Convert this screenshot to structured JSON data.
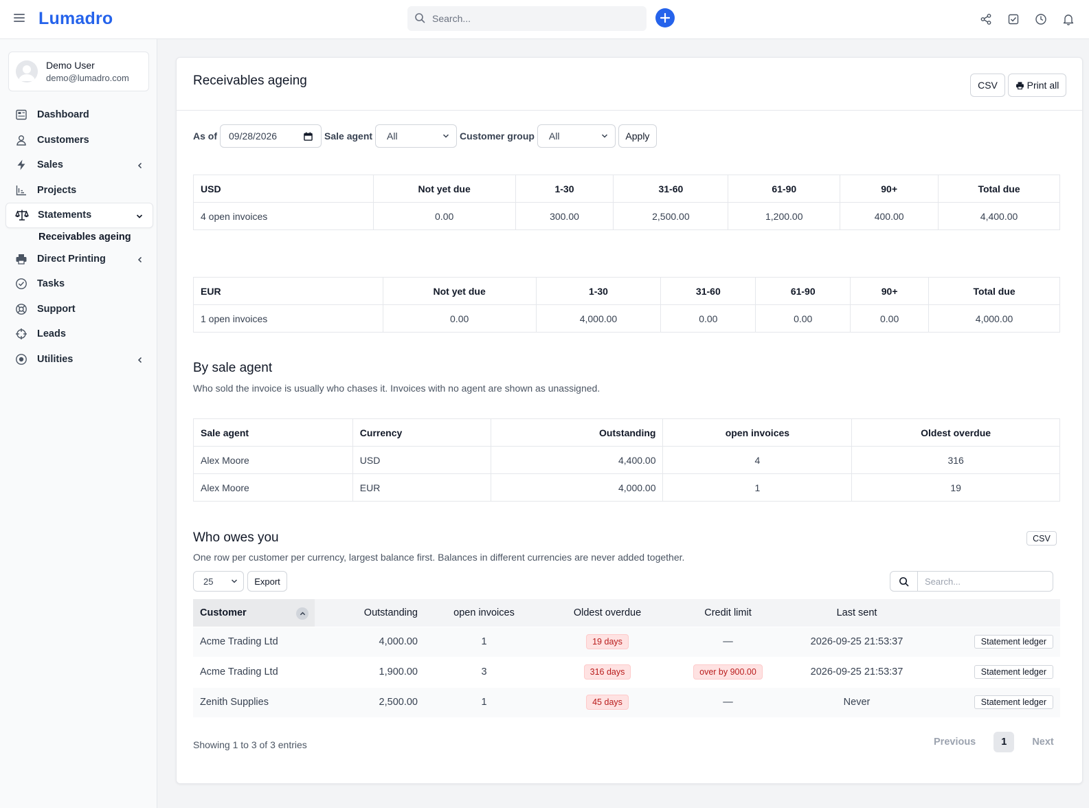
{
  "app": {
    "brand": "Lumadro"
  },
  "topbar": {
    "search_placeholder": "Search..."
  },
  "user": {
    "name": "Demo User",
    "email": "demo@lumadro.com"
  },
  "sidebar": {
    "items": [
      {
        "label": "Dashboard",
        "icon": "dashboard-icon"
      },
      {
        "label": "Customers",
        "icon": "user-icon"
      },
      {
        "label": "Sales",
        "icon": "bolt-icon"
      },
      {
        "label": "Projects",
        "icon": "chart-icon"
      },
      {
        "label": "Statements",
        "icon": "scale-icon"
      },
      {
        "label": "Direct Printing",
        "icon": "printer-icon"
      },
      {
        "label": "Tasks",
        "icon": "check-circle-icon"
      },
      {
        "label": "Support",
        "icon": "lifebuoy-icon"
      },
      {
        "label": "Leads",
        "icon": "crosshair-icon"
      },
      {
        "label": "Utilities",
        "icon": "record-icon"
      }
    ],
    "sub_item": "Receivables ageing"
  },
  "page": {
    "title": "Receivables ageing",
    "csv_label": "CSV",
    "print_label": "Print all"
  },
  "filters": {
    "as_of_label": "As of",
    "as_of_value": "09/28/2026",
    "sale_agent_label": "Sale agent",
    "sale_agent_value": "All",
    "customer_group_label": "Customer group",
    "customer_group_value": "All",
    "apply_label": "Apply"
  },
  "currency_tables": [
    {
      "headers": [
        "USD",
        "Not yet due",
        "1-30",
        "31-60",
        "61-90",
        "90+",
        "Total due"
      ],
      "row": [
        "4 open invoices",
        "0.00",
        "300.00",
        "2,500.00",
        "1,200.00",
        "400.00",
        "4,400.00"
      ]
    },
    {
      "headers": [
        "EUR",
        "Not yet due",
        "1-30",
        "31-60",
        "61-90",
        "90+",
        "Total due"
      ],
      "row": [
        "1 open invoices",
        "0.00",
        "4,000.00",
        "0.00",
        "0.00",
        "0.00",
        "4,000.00"
      ]
    }
  ],
  "agent_section": {
    "title": "By sale agent",
    "description": "Who sold the invoice is usually who chases it. Invoices with no agent are shown as unassigned.",
    "headers": [
      "Sale agent",
      "Currency",
      "Outstanding",
      "open invoices",
      "Oldest overdue"
    ],
    "rows": [
      [
        "Alex Moore",
        "USD",
        "4,400.00",
        "4",
        "316"
      ],
      [
        "Alex Moore",
        "EUR",
        "4,000.00",
        "1",
        "19"
      ]
    ]
  },
  "owes_section": {
    "title": "Who owes you",
    "description": "One row per customer per currency, largest balance first. Balances in different currencies are never added together.",
    "csv_label": "CSV",
    "page_length": "25",
    "export_label": "Export",
    "search_placeholder": "Search...",
    "headers": [
      "Customer",
      "Outstanding",
      "open invoices",
      "Oldest overdue",
      "Credit limit",
      "Last sent",
      ""
    ],
    "rows": [
      {
        "customer": "Acme Trading Ltd",
        "outstanding": "4,000.00",
        "open": "1",
        "overdue": "19 days",
        "credit": "—",
        "credit_badge": false,
        "last_sent": "2026-09-25 21:53:37",
        "action": "Statement ledger"
      },
      {
        "customer": "Acme Trading Ltd",
        "outstanding": "1,900.00",
        "open": "3",
        "overdue": "316 days",
        "credit": "over by 900.00",
        "credit_badge": true,
        "last_sent": "2026-09-25 21:53:37",
        "action": "Statement ledger"
      },
      {
        "customer": "Zenith Supplies",
        "outstanding": "2,500.00",
        "open": "1",
        "overdue": "45 days",
        "credit": "—",
        "credit_badge": false,
        "last_sent": "Never",
        "action": "Statement ledger"
      }
    ],
    "info": "Showing 1 to 3 of 3 entries",
    "pagination": {
      "previous": "Previous",
      "current": "1",
      "next": "Next"
    }
  },
  "colors": {
    "accent": "#2563eb",
    "danger_text": "#b91c1c",
    "danger_bg": "#fee2e2"
  }
}
